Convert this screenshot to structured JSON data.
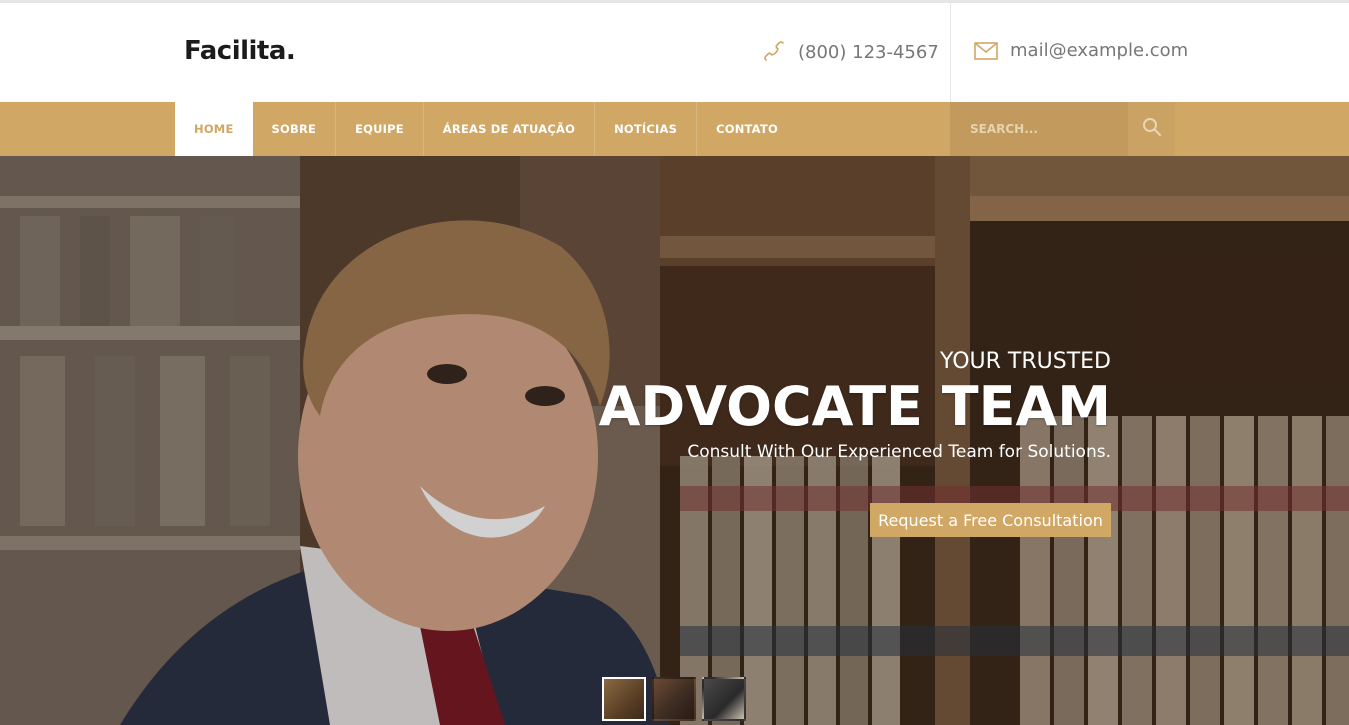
{
  "brand": {
    "logo_text": "Facilita",
    "logo_dot": "."
  },
  "header": {
    "phone": "(800) 123-4567",
    "email": "mail@example.com"
  },
  "nav": {
    "items": [
      {
        "label": "HOME",
        "active": true
      },
      {
        "label": "SOBRE",
        "active": false
      },
      {
        "label": "EQUIPE",
        "active": false
      },
      {
        "label": "ÁREAS DE ATUAÇÃO",
        "active": false
      },
      {
        "label": "NOTÍCIAS",
        "active": false
      },
      {
        "label": "CONTATO",
        "active": false
      }
    ],
    "search_placeholder": "SEARCH..."
  },
  "hero": {
    "pre_title": "YOUR TRUSTED",
    "title": "ADVOCATE TEAM",
    "subtitle": "Consult With Our Experienced Team for Solutions.",
    "cta_label": "Request a Free Consultation",
    "slides_count": 3,
    "active_slide": 1
  },
  "colors": {
    "accent": "#d0a765",
    "nav_search_bg": "#c29a5d",
    "text_dark": "#1b1b1b",
    "text_muted": "#777777"
  },
  "icons": {
    "phone": "phone-icon",
    "mail": "mail-icon",
    "search": "search-icon"
  }
}
